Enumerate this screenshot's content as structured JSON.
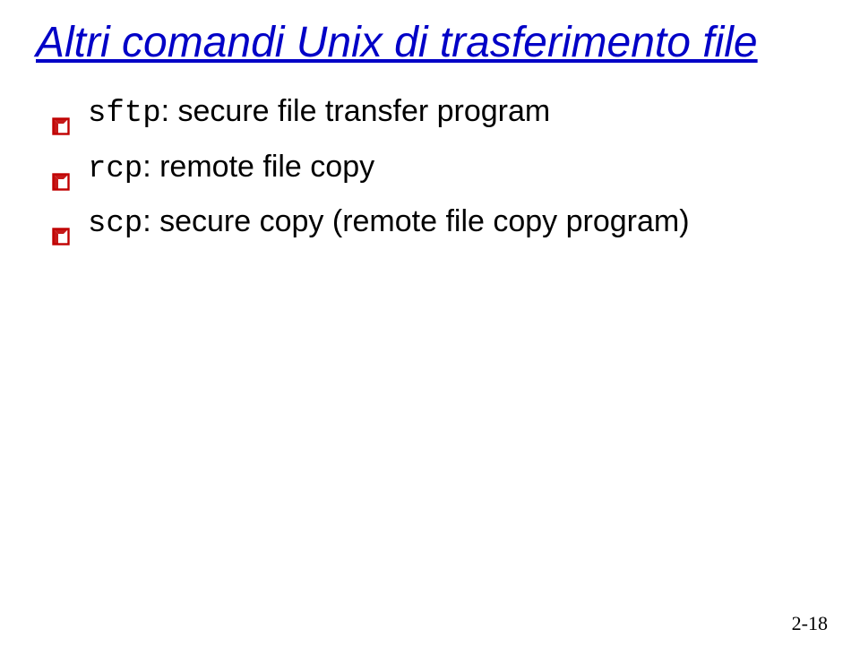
{
  "title": "Altri comandi Unix di trasferimento file",
  "bullets": [
    {
      "cmd": "sftp",
      "desc": ": secure file transfer program"
    },
    {
      "cmd": "rcp",
      "desc": ": remote file copy"
    },
    {
      "cmd": "scp",
      "desc": ": secure copy (remote file copy program)"
    }
  ],
  "page_number": "2-18",
  "colors": {
    "title": "#0101c7",
    "bullet_stroke": "#c00000"
  }
}
